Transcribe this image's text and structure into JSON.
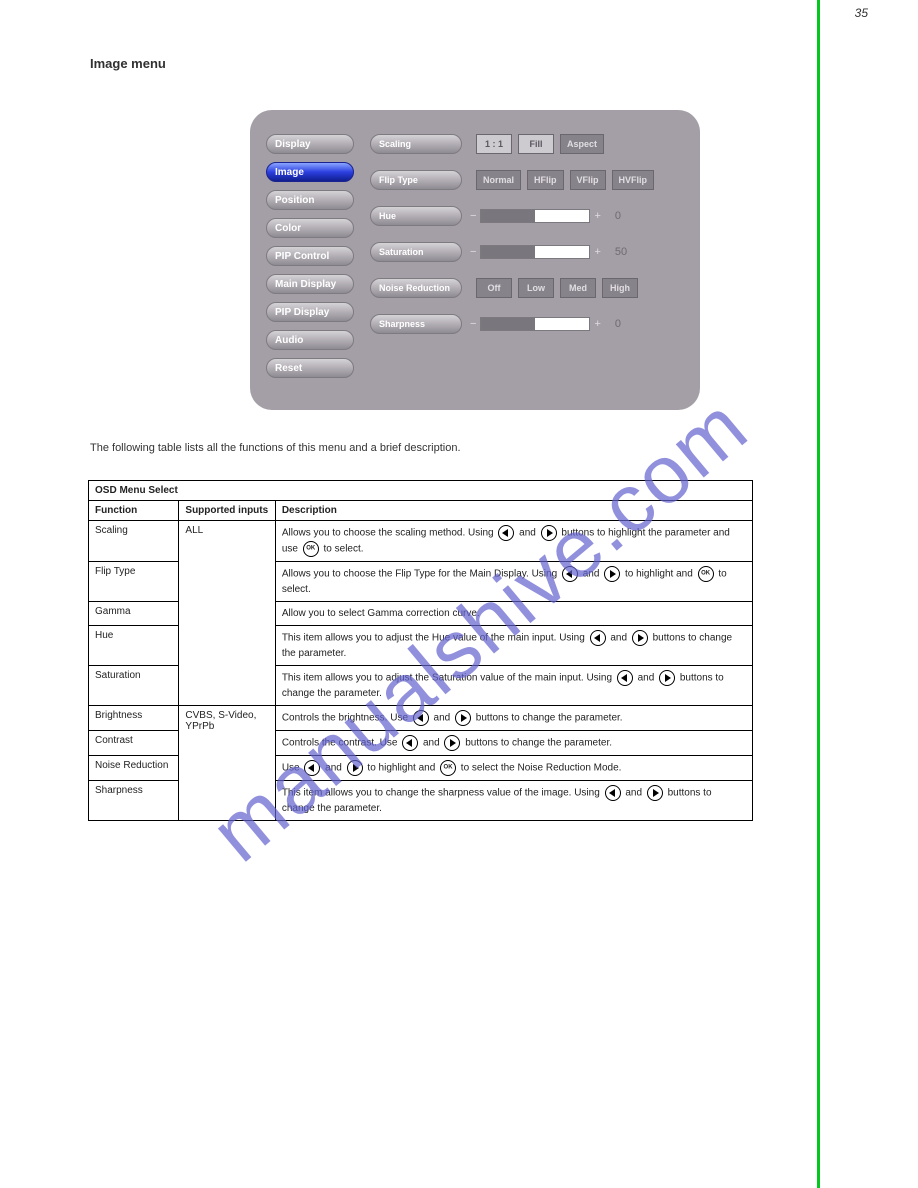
{
  "page_number": "35",
  "heading": "Image menu",
  "watermark": "manualshive.com",
  "osd": {
    "menu": [
      "Display",
      "Image",
      "Position",
      "Color",
      "PIP Control",
      "Main Display",
      "PIP Display",
      "Audio",
      "Reset"
    ],
    "active": "Image",
    "scaling": {
      "label": "Scaling",
      "opts": [
        "1 : 1",
        "Fill",
        "Aspect"
      ],
      "sel": "Fill"
    },
    "flip": {
      "label": "Flip Type",
      "opts": [
        "Normal",
        "HFlip",
        "VFlip",
        "HVFlip"
      ],
      "sel": null
    },
    "hue": {
      "label": "Hue",
      "value": 0,
      "fill": 50
    },
    "sat": {
      "label": "Saturation",
      "value": 50,
      "fill": 50
    },
    "noise": {
      "label": "Noise Reduction",
      "opts": [
        "Off",
        "Low",
        "Med",
        "High"
      ],
      "sel": null
    },
    "sharp": {
      "label": "Sharpness",
      "value": 0,
      "fill": 50
    }
  },
  "intro": "The following table lists all the functions of this menu and a brief description.",
  "table": {
    "hdr_top": "OSD Menu Select",
    "hdr_c1": "Function",
    "hdr_c2": "Supported inputs",
    "hdr_c3": "Description",
    "rows": [
      {
        "fn": "Scaling",
        "inputs": "ALL",
        "inputs_rowspan": 5,
        "desc_parts": [
          {
            "t": "Allows you to choose the scaling method. Using "
          },
          {
            "i": "l"
          },
          {
            "t": " and "
          },
          {
            "i": "r"
          },
          {
            "t": " buttons to highlight the parameter and use "
          },
          {
            "i": "ok"
          },
          {
            "t": " to select."
          }
        ]
      },
      {
        "fn": "Flip Type",
        "desc_parts": [
          {
            "t": "Allows you to choose the Flip Type for the Main Display. Using "
          },
          {
            "i": "l"
          },
          {
            "t": " and "
          },
          {
            "i": "r"
          },
          {
            "t": " to highlight and "
          },
          {
            "i": "ok"
          },
          {
            "t": " to select."
          }
        ]
      },
      {
        "fn": "Gamma",
        "desc_parts": [
          {
            "t": "Allow you to select Gamma correction curve."
          }
        ]
      },
      {
        "fn": "Hue",
        "desc_parts": [
          {
            "t": "This item allows you to adjust the Hue value of the main input. Using "
          },
          {
            "i": "l"
          },
          {
            "t": " and "
          },
          {
            "i": "r"
          },
          {
            "t": " buttons to change the parameter."
          }
        ]
      },
      {
        "fn": "Saturation",
        "desc_parts": [
          {
            "t": "This item allows you to adjust the Saturation value of the main input. Using "
          },
          {
            "i": "l"
          },
          {
            "t": " and "
          },
          {
            "i": "r"
          },
          {
            "t": " buttons to change the parameter."
          }
        ]
      },
      {
        "fn": "Brightness",
        "inputs": "CVBS, S-Video,  YPrPb",
        "inputs_rowspan": 4,
        "desc_parts": [
          {
            "t": "Controls the brightness. Use "
          },
          {
            "i": "l"
          },
          {
            "t": " and "
          },
          {
            "i": "r"
          },
          {
            "t": " buttons to change the parameter."
          }
        ]
      },
      {
        "fn": "Contrast",
        "desc_parts": [
          {
            "t": "Controls the contrast. Use "
          },
          {
            "i": "l"
          },
          {
            "t": " and "
          },
          {
            "i": "r"
          },
          {
            "t": " buttons to change the parameter."
          }
        ]
      },
      {
        "fn": "Noise Reduction",
        "desc_parts": [
          {
            "t": "Use "
          },
          {
            "i": "l"
          },
          {
            "t": " and "
          },
          {
            "i": "r"
          },
          {
            "t": " to highlight and "
          },
          {
            "i": "ok"
          },
          {
            "t": " to select the Noise Reduction Mode."
          }
        ]
      },
      {
        "fn": "Sharpness",
        "desc_parts": [
          {
            "t": "This item allows you to change the sharpness value of the image. Using "
          },
          {
            "i": "l"
          },
          {
            "t": " and "
          },
          {
            "i": "r"
          },
          {
            "t": " buttons to change the parameter."
          }
        ]
      }
    ]
  }
}
